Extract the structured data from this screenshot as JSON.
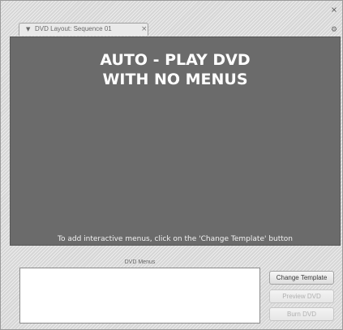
{
  "window": {
    "close_glyph": "×",
    "menu_glyph": "⚙"
  },
  "tab": {
    "arrow_glyph": "▼",
    "label": "DVD Layout: Sequence 01",
    "close_glyph": "×"
  },
  "preview": {
    "title_line1": "AUTO - PLAY DVD",
    "title_line2": "WITH NO MENUS",
    "hint": "To add interactive menus, click on the 'Change Template' button"
  },
  "menus": {
    "label": "DVD Menus"
  },
  "buttons": {
    "change_template": "Change Template",
    "preview_dvd": "Preview DVD",
    "burn_dvd": "Burn DVD"
  },
  "colors": {
    "preview_background": "#6b6b6b",
    "panel_background": "#d6d6d6"
  }
}
